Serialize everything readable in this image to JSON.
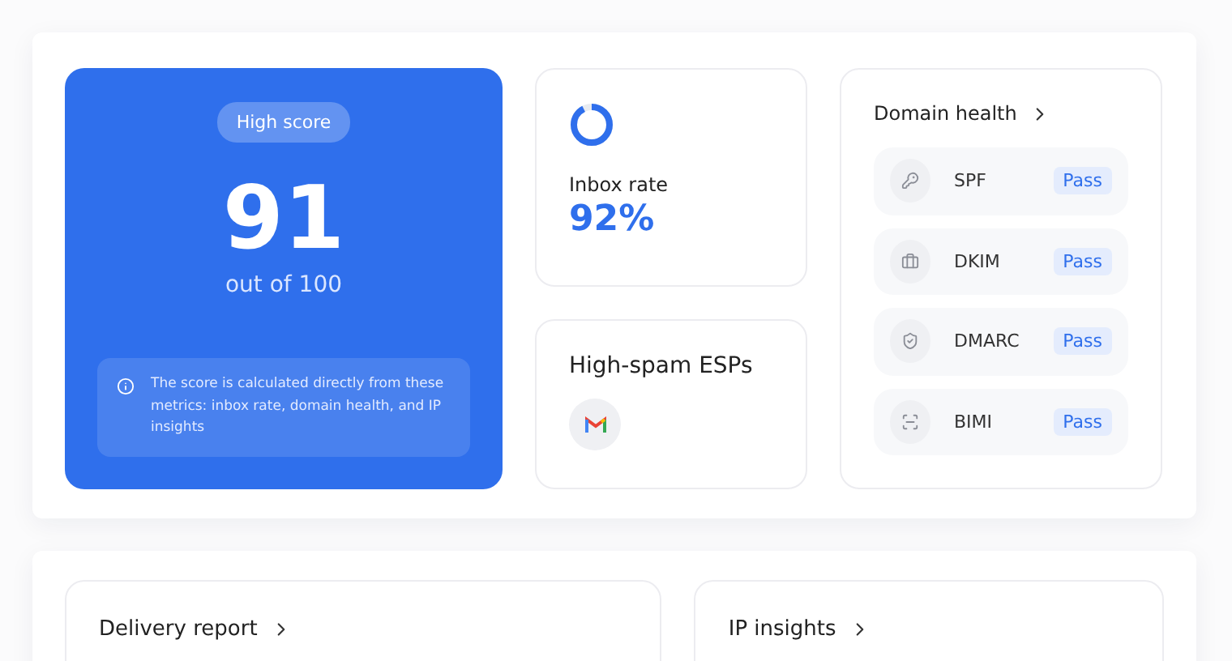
{
  "score_card": {
    "badge": "High score",
    "score": "91",
    "scale": "out of 100",
    "note": "The score is calculated directly from these metrics: inbox rate, domain health, and IP insights"
  },
  "inbox_rate": {
    "label": "Inbox rate",
    "value": "92%",
    "level": 0.92
  },
  "high_spam_esps": {
    "title": "High-spam ESPs"
  },
  "domain_health": {
    "title": "Domain health",
    "records": [
      {
        "name": "SPF",
        "status": "Pass"
      },
      {
        "name": "DKIM",
        "status": "Pass"
      },
      {
        "name": "DMARC",
        "status": "Pass"
      },
      {
        "name": "BIMI",
        "status": "Pass"
      }
    ]
  },
  "bottom_cards": [
    {
      "title": "Delivery report"
    },
    {
      "title": "IP insights"
    }
  ]
}
